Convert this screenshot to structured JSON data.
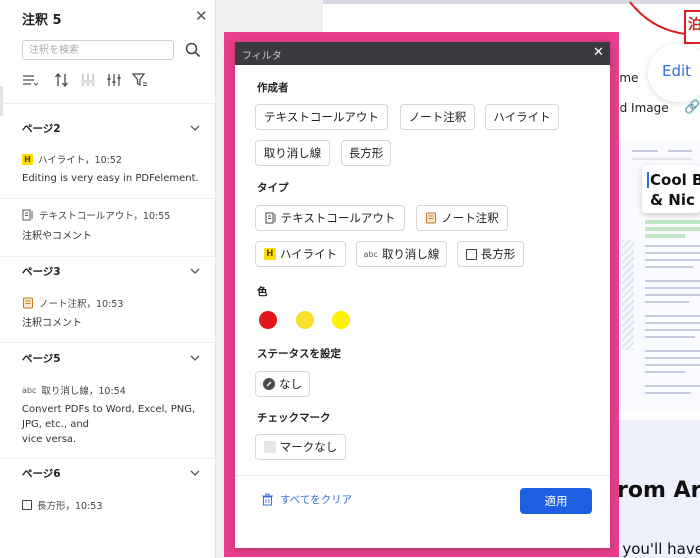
{
  "panel": {
    "title": "注釈 5",
    "search_placeholder": "注釈を検索",
    "sections": [
      {
        "header": "ページ2",
        "items": [
          {
            "icon": "highlight-icon",
            "meta": "ハイライト，10:52",
            "text": "Editing is very easy in PDFelement."
          },
          {
            "icon": "text-callout-icon",
            "meta": "テキストコールアウト，10:55",
            "text": "注釈やコメント"
          }
        ]
      },
      {
        "header": "ページ3",
        "items": [
          {
            "icon": "note-icon",
            "meta": "ノート注釈，10:53",
            "text": "注釈コメント"
          }
        ]
      },
      {
        "header": "ページ5",
        "items": [
          {
            "icon": "strikethrough-icon",
            "meta": "取り消し線，10:54",
            "text_lines": [
              "Convert PDFs to Word, Excel, PNG,",
              "JPG, etc., and",
              "vice versa."
            ]
          }
        ]
      },
      {
        "header": "ページ6",
        "items": [
          {
            "icon": "rectangle-icon",
            "meta": "長方形，10:53"
          }
        ]
      }
    ]
  },
  "background": {
    "edit_label": "Edit",
    "home_label": "ome",
    "add_image_label": "dd Image",
    "red_glyph": "泊",
    "thumb_title": "Cool B\n& Nic",
    "from_text": "rom Ar",
    "when_text": "When you need to create a PDF, you'll have m"
  },
  "modal": {
    "title": "フィルタ",
    "author_label": "作成者",
    "authors": [
      "テキストコールアウト",
      "ノート注釈",
      "ハイライト",
      "取り消し線",
      "長方形"
    ],
    "type_label": "タイプ",
    "types": [
      "テキストコールアウト",
      "ノート注釈",
      "ハイライト",
      "取り消し線",
      "長方形"
    ],
    "type_icons": [
      "text-callout-icon",
      "note-icon",
      "highlight-icon",
      "strikethrough-icon",
      "rectangle-icon"
    ],
    "color_label": "色",
    "colors": [
      "#e0161b",
      "#f7e12e",
      "#fff200"
    ],
    "status_label": "ステータスを設定",
    "status_none": "なし",
    "checkmark_label": "チェックマーク",
    "checkmark_none": "マークなし",
    "clear_all": "すべてをクリア",
    "apply": "適用"
  }
}
